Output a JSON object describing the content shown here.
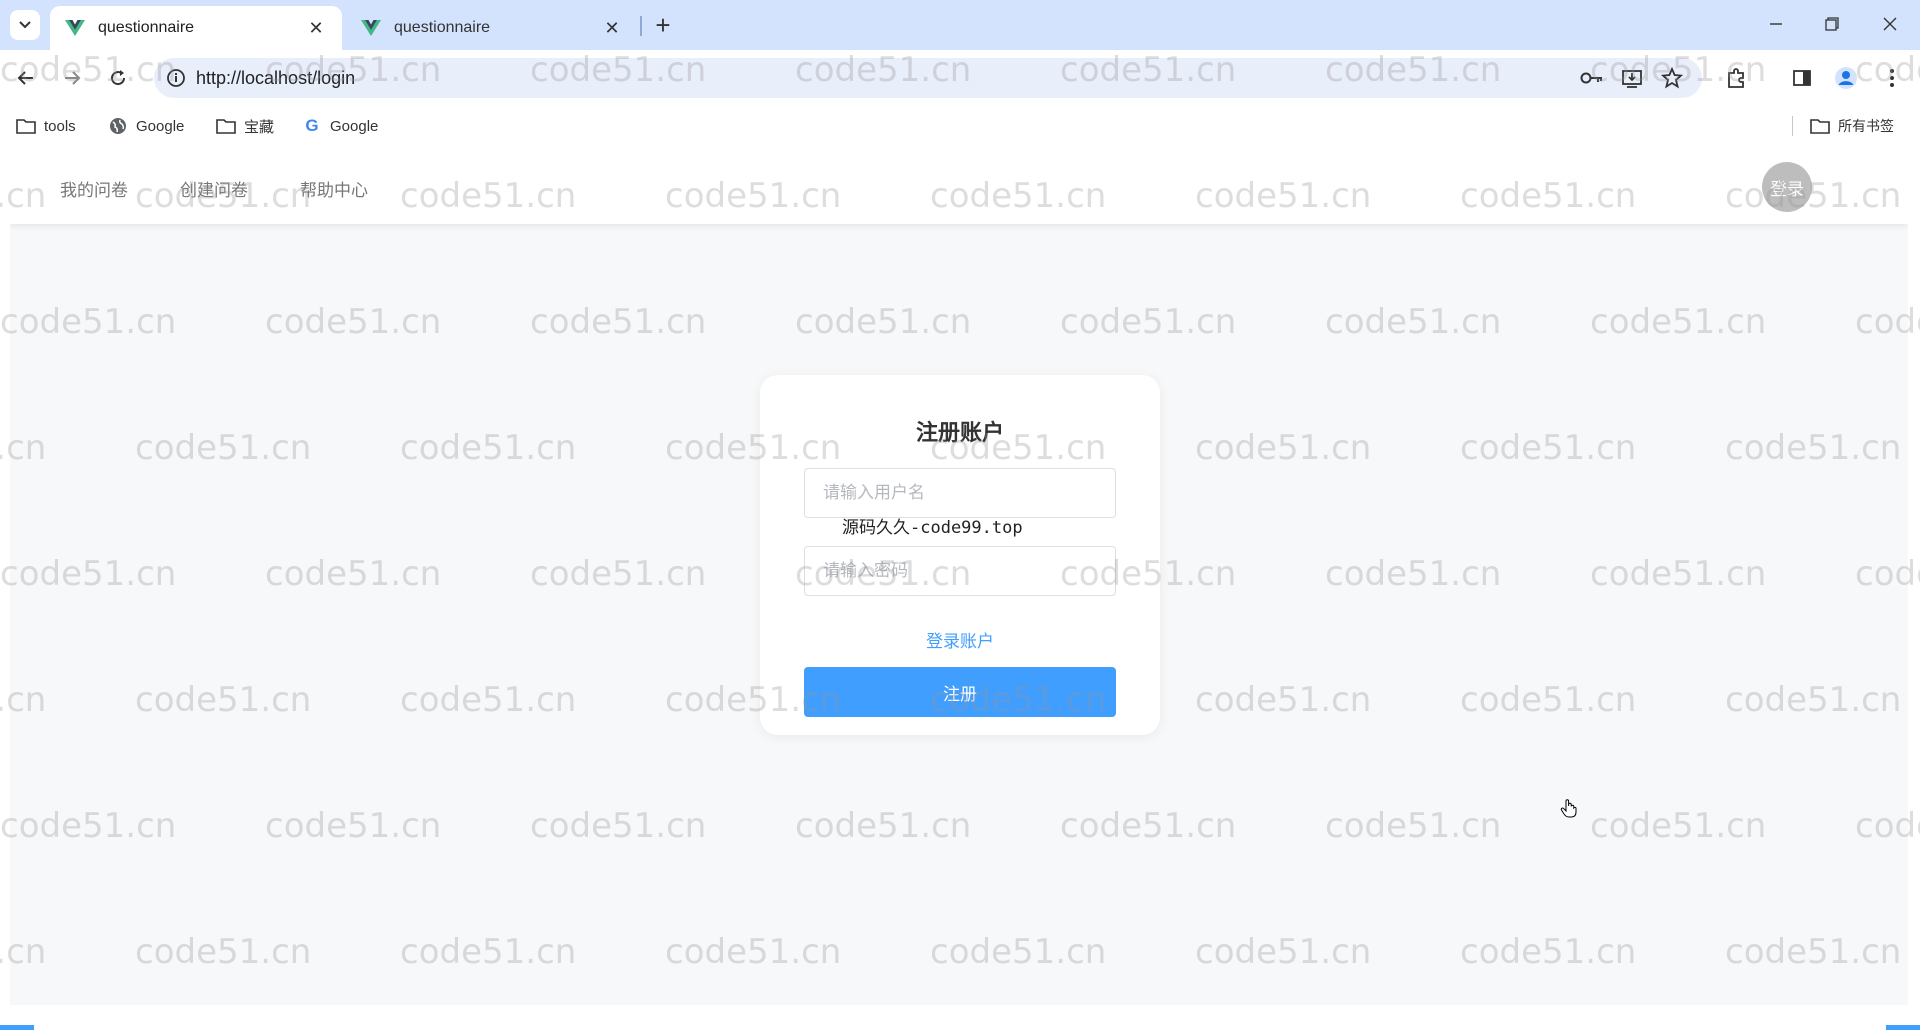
{
  "browser": {
    "tabs": [
      {
        "title": "questionnaire",
        "active": true
      },
      {
        "title": "questionnaire",
        "active": false
      }
    ],
    "url": "http://localhost/login",
    "bookmarks": [
      {
        "label": "tools",
        "icon": "folder-icon"
      },
      {
        "label": "Google",
        "icon": "globe-icon"
      },
      {
        "label": "宝藏",
        "icon": "folder-icon"
      },
      {
        "label": "Google",
        "icon": "google-g-icon"
      }
    ],
    "all_bookmarks_label": "所有书签"
  },
  "site_nav": {
    "items": [
      "我的问卷",
      "创建问卷",
      "帮助中心"
    ],
    "avatar_label": "登录"
  },
  "register_card": {
    "title": "注册账户",
    "username_placeholder": "请输入用户名",
    "password_placeholder": "请输入密码",
    "overlay_text": "源码久久-code99.top",
    "login_link": "登录账户",
    "submit_label": "注册"
  },
  "watermark_text": "code51.cn",
  "colors": {
    "accent": "#409eff",
    "tabstrip": "#d3e3fd",
    "page_bg": "#f7f8f9",
    "vue_green": "#42b883"
  }
}
